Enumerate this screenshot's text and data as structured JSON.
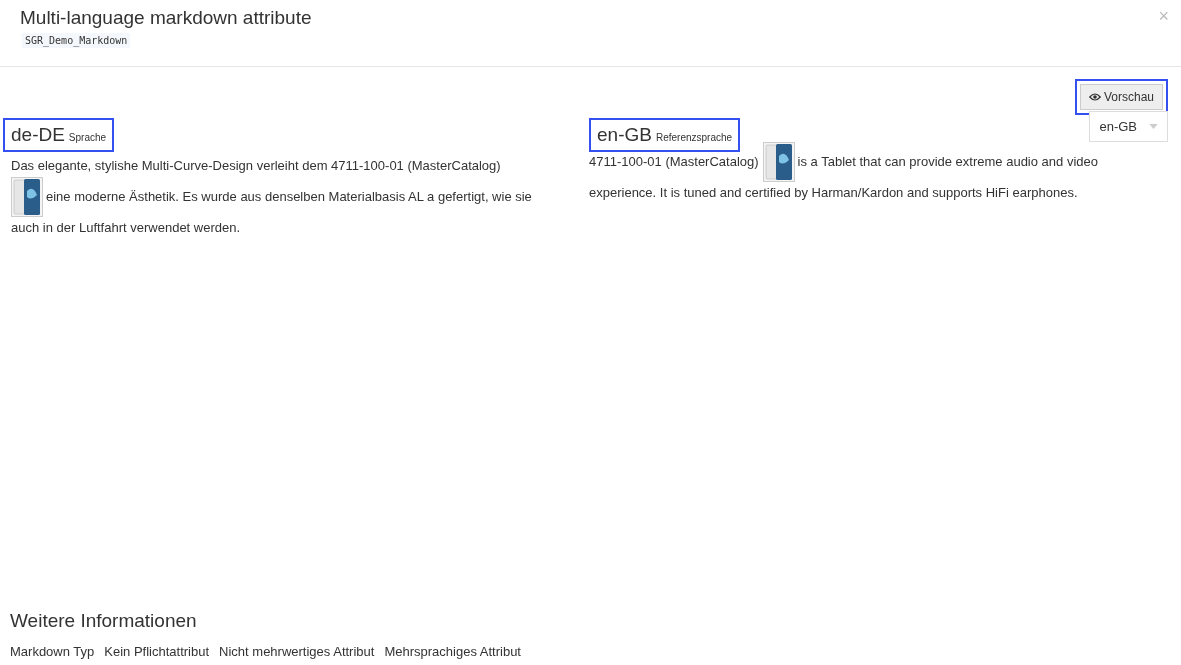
{
  "dialog": {
    "title": "Multi-language markdown attribute",
    "code": "SGR_Demo_Markdown",
    "close": "×"
  },
  "preview_button": {
    "label": "Vorschau",
    "highlighted": true
  },
  "columns": [
    {
      "language": "de-DE",
      "caption": "Sprache",
      "highlighted": true,
      "lines": [
        [
          {
            "kind": "text",
            "text": "Das elegante, stylishe Multi-Curve-Design verleiht dem 4711-100-01 (MasterCatalog)"
          }
        ],
        [
          {
            "kind": "image"
          },
          {
            "kind": "text",
            "text": "eine moderne Ästhetik. Es wurde aus denselben Materialbasis AL a gefertigt, wie sie"
          }
        ],
        [
          {
            "kind": "text",
            "text": "auch in der Luftfahrt verwendet werden."
          }
        ]
      ]
    },
    {
      "language": "en-GB",
      "caption": "Referenzsprache",
      "highlighted": true,
      "selector": "en-GB",
      "lines": [
        [
          {
            "kind": "text",
            "text": "4711-100-01 (MasterCatalog)"
          },
          {
            "kind": "image"
          },
          {
            "kind": "text",
            "text": "is a Tablet that can provide extreme audio and video"
          }
        ],
        [
          {
            "kind": "text",
            "text": "experience. It is tuned and certified by Harman/Kardon and supports HiFi earphones."
          }
        ]
      ]
    }
  ],
  "more_info": {
    "title": "Weitere Informationen",
    "tags": [
      "Markdown Typ",
      "Kein Pflichtattribut",
      "Nicht mehrwertiges Attribut",
      "Mehrsprachiges Attribut"
    ]
  }
}
